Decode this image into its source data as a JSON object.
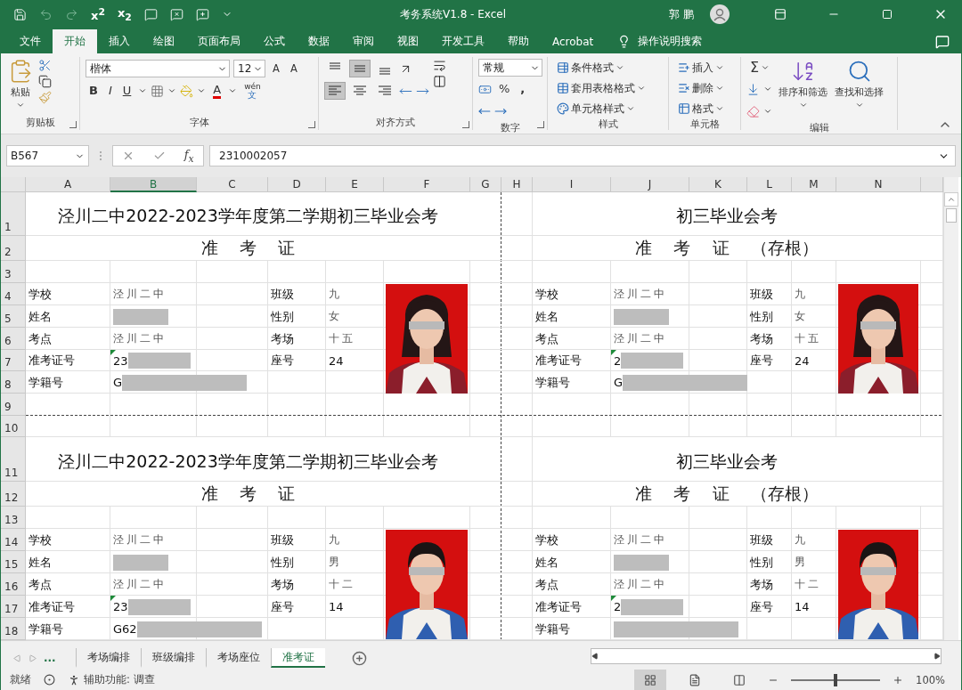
{
  "window": {
    "title": "考务系统V1.8  -  Excel",
    "user": "郭 鹏"
  },
  "quick_access": {
    "superscript": "x$^{2}$",
    "subscript": "x$_{2}$"
  },
  "menu_tabs": [
    {
      "label": "文件",
      "selected": false
    },
    {
      "label": "开始",
      "selected": true
    },
    {
      "label": "插入",
      "selected": false
    },
    {
      "label": "绘图",
      "selected": false
    },
    {
      "label": "页面布局",
      "selected": false
    },
    {
      "label": "公式",
      "selected": false
    },
    {
      "label": "数据",
      "selected": false
    },
    {
      "label": "审阅",
      "selected": false
    },
    {
      "label": "视图",
      "selected": false
    },
    {
      "label": "开发工具",
      "selected": false
    },
    {
      "label": "帮助",
      "selected": false
    },
    {
      "label": "Acrobat",
      "selected": false
    }
  ],
  "tell_me": "操作说明搜索",
  "ribbon": {
    "clipboard": {
      "label": "剪贴板",
      "paste": "粘贴"
    },
    "font": {
      "label": "字体",
      "font_name": "楷体",
      "font_size": "12",
      "grow": "A",
      "shrink": "A",
      "bold": "B",
      "italic": "I",
      "underline": "U",
      "font_color": "A",
      "phonetic": {
        "ruby": "wén",
        "base": "文"
      }
    },
    "alignment": {
      "label": "对齐方式",
      "vertical": [
        {
          "selected": false
        },
        {
          "selected": true
        },
        {
          "selected": false
        }
      ],
      "horizontal": [
        {
          "selected": true
        },
        {
          "selected": false
        },
        {
          "selected": false
        }
      ]
    },
    "number": {
      "label": "数字",
      "format": "常规",
      "percent": "%",
      "comma": ","
    },
    "styles": {
      "label": "样式",
      "items": [
        "条件格式",
        "套用表格格式",
        "单元格样式"
      ]
    },
    "cells": {
      "label": "单元格",
      "items": [
        "插入",
        "删除",
        "格式"
      ]
    },
    "editing": {
      "label": "编辑",
      "sum": "Σ",
      "sort": "排序和筛选",
      "find": "查找和选择"
    }
  },
  "formula_bar": {
    "name_box": "B567",
    "function_label": "f$_{x}$",
    "value": "2310002057"
  },
  "sheet": {
    "columns": [
      {
        "label": "A",
        "selected": false
      },
      {
        "label": "B",
        "selected": true
      },
      {
        "label": "C",
        "selected": false
      },
      {
        "label": "D",
        "selected": false
      },
      {
        "label": "E",
        "selected": false
      },
      {
        "label": "F",
        "selected": false
      },
      {
        "label": "G",
        "selected": false
      },
      {
        "label": "H",
        "selected": false
      },
      {
        "label": "I",
        "selected": false
      },
      {
        "label": "J",
        "selected": false
      },
      {
        "label": "K",
        "selected": false
      },
      {
        "label": "L",
        "selected": false
      },
      {
        "label": "M",
        "selected": false
      },
      {
        "label": "N",
        "selected": false
      }
    ],
    "rows": [
      "1",
      "2",
      "3",
      "4",
      "5",
      "6",
      "7",
      "8",
      "9",
      "10",
      "11",
      "12",
      "13",
      "14",
      "15",
      "16",
      "17",
      "18"
    ],
    "blocks": [
      {
        "left": {
          "title": "泾川二中2022-2023学年度第二学期初三毕业会考",
          "subtitle": "准 考 证",
          "rows": [
            {
              "label": "学校",
              "value": "泾川二中",
              "redacted": false,
              "error_flag": false,
              "label_2": "班级",
              "value_2": "九"
            },
            {
              "label": "姓名",
              "redacted": true,
              "error_flag": false,
              "label_2": "性别",
              "value_2": "女"
            },
            {
              "label": "考点",
              "value": "泾川二中",
              "redacted": false,
              "error_flag": false,
              "label_2": "考场",
              "value_2": "十五"
            },
            {
              "label": "准考证号",
              "value": "23",
              "redacted": true,
              "error_flag": true,
              "label_2": "座号",
              "value_2": "24"
            },
            {
              "label": "学籍号",
              "value": "G",
              "redacted": true,
              "error_flag": false
            }
          ]
        },
        "right": {
          "title": "初三毕业会考",
          "subtitle": "准 考 证 （存根）",
          "rows": [
            {
              "label": "学校",
              "value": "泾川二中",
              "redacted": false,
              "error_flag": false,
              "label_2": "班级",
              "value_2": "九"
            },
            {
              "label": "姓名",
              "redacted": true,
              "error_flag": false,
              "label_2": "性别",
              "value_2": "女"
            },
            {
              "label": "考点",
              "value": "泾川二中",
              "redacted": false,
              "error_flag": false,
              "label_2": "考场",
              "value_2": "十五"
            },
            {
              "label": "准考证号",
              "value": "2",
              "redacted": true,
              "error_flag": true,
              "label_2": "座号",
              "value_2": "24"
            },
            {
              "label": "学籍号",
              "value": "G",
              "redacted": true,
              "error_flag": false
            }
          ]
        }
      },
      {
        "left": {
          "title": "泾川二中2022-2023学年度第二学期初三毕业会考",
          "subtitle": "准 考 证",
          "rows": [
            {
              "label": "学校",
              "value": "泾川二中",
              "redacted": false,
              "error_flag": false,
              "label_2": "班级",
              "value_2": "九"
            },
            {
              "label": "姓名",
              "redacted": true,
              "error_flag": false,
              "label_2": "性别",
              "value_2": "男"
            },
            {
              "label": "考点",
              "value": "泾川二中",
              "redacted": false,
              "error_flag": false,
              "label_2": "考场",
              "value_2": "十二"
            },
            {
              "label": "准考证号",
              "value": "23",
              "redacted": true,
              "error_flag": true,
              "label_2": "座号",
              "value_2": "14"
            },
            {
              "label": "学籍号",
              "value": "G62",
              "redacted": true,
              "error_flag": false
            }
          ]
        },
        "right": {
          "title": "初三毕业会考",
          "subtitle": "准 考 证 （存根）",
          "rows": [
            {
              "label": "学校",
              "value": "泾川二中",
              "redacted": false,
              "error_flag": false,
              "label_2": "班级",
              "value_2": "九"
            },
            {
              "label": "姓名",
              "redacted": true,
              "error_flag": false,
              "label_2": "性别",
              "value_2": "男"
            },
            {
              "label": "考点",
              "value": "泾川二中",
              "redacted": false,
              "error_flag": false,
              "label_2": "考场",
              "value_2": "十二"
            },
            {
              "label": "准考证号",
              "value": "2",
              "redacted": true,
              "error_flag": true,
              "label_2": "座号",
              "value_2": "14"
            },
            {
              "label": "学籍号",
              "redacted": true,
              "error_flag": false
            }
          ]
        }
      }
    ]
  },
  "sheet_tabs": {
    "overflow": "...",
    "tabs": [
      {
        "label": "考场编排",
        "selected": false
      },
      {
        "label": "班级编排",
        "selected": false
      },
      {
        "label": "考场座位",
        "selected": false
      },
      {
        "label": "准考证",
        "selected": true
      }
    ]
  },
  "status_bar": {
    "ready": "就绪",
    "accessibility": "辅助功能: 调查",
    "views": [
      {
        "selected": true
      },
      {
        "selected": false
      },
      {
        "selected": false
      }
    ],
    "zoom": {
      "level": 0.5,
      "reading": "100%"
    }
  }
}
